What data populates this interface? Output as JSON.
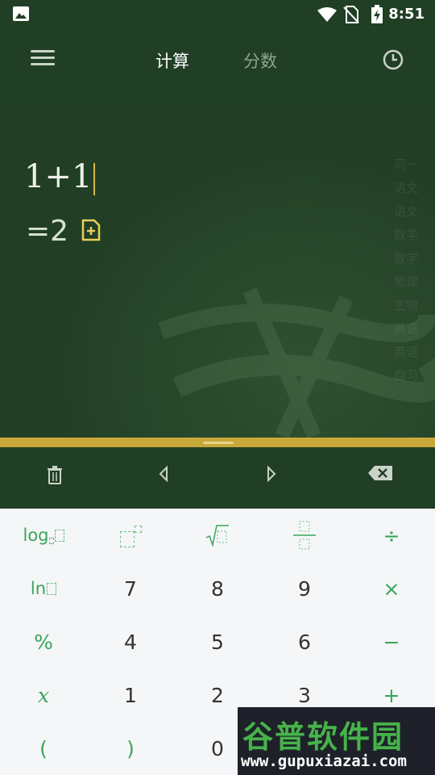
{
  "status_bar": {
    "time": "8:51"
  },
  "tabs": [
    {
      "label": "计算"
    },
    {
      "label": "分数"
    }
  ],
  "display": {
    "expression": "1+1",
    "result": "=2",
    "subjects": [
      "同一",
      "语文",
      "语文",
      "数学",
      "数学",
      "地理",
      "生物",
      "英语",
      "英语",
      "自习"
    ]
  },
  "keypad": {
    "row1": [
      "log",
      "",
      "",
      "",
      "÷"
    ],
    "row2": [
      "ln",
      "7",
      "8",
      "9",
      "×"
    ],
    "row3": [
      "%",
      "4",
      "5",
      "6",
      "−"
    ],
    "row4": [
      "x",
      "1",
      "2",
      "3",
      "+"
    ],
    "row5": [
      "(",
      ")",
      "0"
    ]
  },
  "watermark": {
    "title": "谷普软件园",
    "url": "www.gupuxiazai.com"
  },
  "colors": {
    "accent": "#c9a83a",
    "key_green": "#3aa55a",
    "board": "#213f24"
  }
}
